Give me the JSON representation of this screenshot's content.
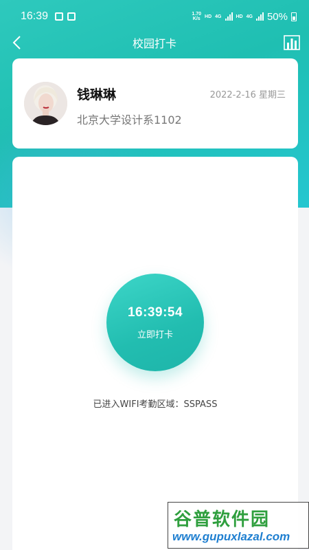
{
  "status_bar": {
    "time": "16:39",
    "net_speed_top": "1.70",
    "net_speed_bottom": "K/s",
    "hd1": "HD",
    "net1": "4G",
    "hd2": "HD",
    "net2": "4G",
    "battery": "50%"
  },
  "nav": {
    "title": "校园打卡",
    "back_icon": "chevron-left-icon",
    "stats_icon": "bar-chart-icon"
  },
  "profile": {
    "name": "钱琳琳",
    "department": "北京大学设计系1102",
    "date": "2022-2-16 星期三"
  },
  "punch": {
    "time": "16:39:54",
    "label": "立即打卡"
  },
  "wifi_status": "已进入WIFI考勤区域：SSPASS",
  "watermark": {
    "title": "谷普软件园",
    "url": "www.gupuxlazal.com"
  },
  "colors": {
    "primary": "#22bdb0",
    "primary_light": "#3dd6c8"
  }
}
